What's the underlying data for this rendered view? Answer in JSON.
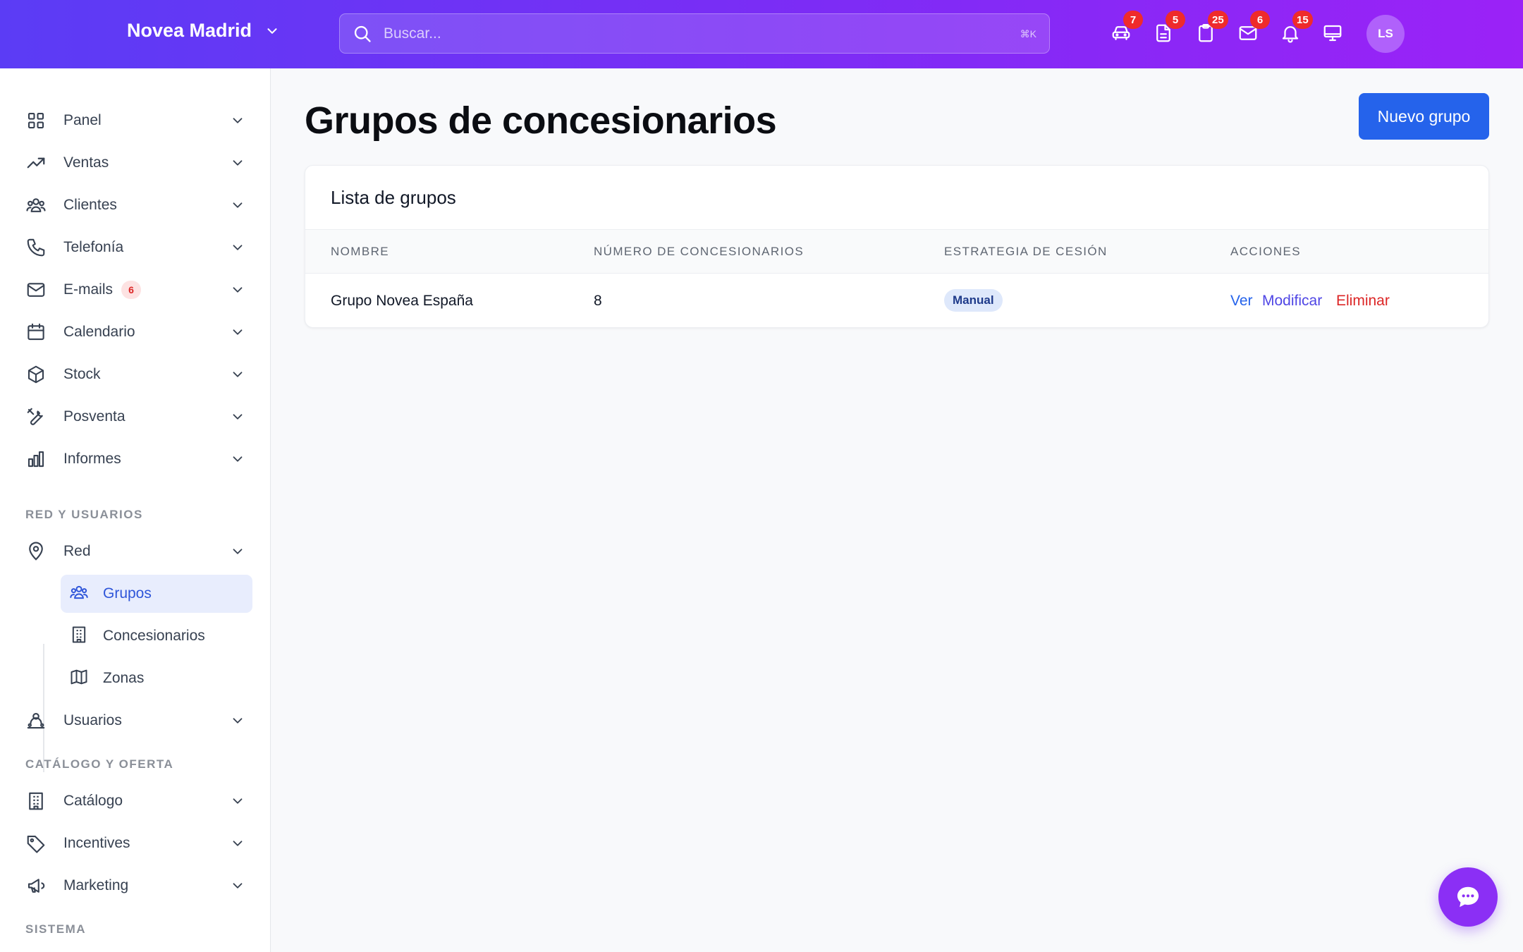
{
  "header": {
    "brand": "Novea Madrid",
    "search_placeholder": "Buscar...",
    "search_shortcut": "⌘K",
    "icons": [
      {
        "name": "car-icon",
        "badge": "7"
      },
      {
        "name": "document-icon",
        "badge": "5"
      },
      {
        "name": "clipboard-icon",
        "badge": "25"
      },
      {
        "name": "mail-icon",
        "badge": "6"
      },
      {
        "name": "bell-icon",
        "badge": "15"
      },
      {
        "name": "monitor-icon",
        "badge": ""
      }
    ],
    "avatar_initials": "LS"
  },
  "sidebar": {
    "items": [
      {
        "label": "Panel",
        "icon": "grid-icon"
      },
      {
        "label": "Ventas",
        "icon": "trending-up-icon"
      },
      {
        "label": "Clientes",
        "icon": "users-icon"
      },
      {
        "label": "Telefonía",
        "icon": "phone-icon"
      },
      {
        "label": "E-mails",
        "icon": "mail-icon",
        "badge": "6"
      },
      {
        "label": "Calendario",
        "icon": "calendar-icon"
      },
      {
        "label": "Stock",
        "icon": "cube-icon"
      },
      {
        "label": "Posventa",
        "icon": "tools-icon"
      },
      {
        "label": "Informes",
        "icon": "bar-chart-icon"
      }
    ],
    "section_network": "RED Y USUARIOS",
    "red": {
      "label": "Red",
      "icon": "map-pin-icon"
    },
    "red_children": [
      {
        "label": "Grupos",
        "icon": "users-icon",
        "active": true
      },
      {
        "label": "Concesionarios",
        "icon": "building-icon"
      },
      {
        "label": "Zonas",
        "icon": "map-icon"
      }
    ],
    "usuarios": {
      "label": "Usuarios",
      "icon": "user-group-icon"
    },
    "section_catalog": "CATÁLOGO Y OFERTA",
    "catalog_items": [
      {
        "label": "Catálogo",
        "icon": "building-icon"
      },
      {
        "label": "Incentives",
        "icon": "tag-icon"
      },
      {
        "label": "Marketing",
        "icon": "megaphone-icon"
      }
    ],
    "section_system": "SISTEMA"
  },
  "main": {
    "title": "Grupos de concesionarios",
    "new_button": "Nuevo grupo",
    "card_title": "Lista de grupos",
    "columns": [
      "NOMBRE",
      "NÚMERO DE CONCESIONARIOS",
      "ESTRATEGIA DE CESIÓN",
      "ACCIONES"
    ],
    "rows": [
      {
        "nombre": "Grupo Novea España",
        "numero": "8",
        "estrategia": "Manual",
        "acciones": {
          "ver": "Ver",
          "modificar": "Modificar",
          "eliminar": "Eliminar"
        }
      }
    ]
  },
  "colors": {
    "header_gradient_start": "#5b3cf5",
    "header_gradient_end": "#9b22f7",
    "primary": "#2563eb",
    "danger": "#dc2626",
    "fab": "#8b2ff5"
  }
}
